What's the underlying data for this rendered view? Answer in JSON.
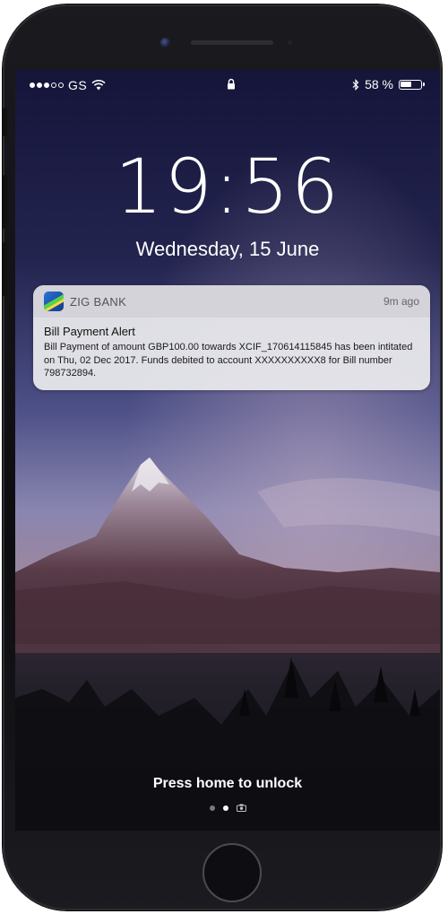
{
  "status_bar": {
    "carrier": "GS",
    "signal_strength": 3,
    "signal_max": 5,
    "battery_label": "58 %",
    "battery_level": 0.58,
    "icons": [
      "wifi-icon",
      "lock-icon",
      "bluetooth-icon",
      "battery-icon"
    ]
  },
  "lock_screen": {
    "time": "19:56",
    "date": "Wednesday, 15 June"
  },
  "notification": {
    "app_name": "ZIG BANK",
    "time_ago": "9m ago",
    "title": "Bill Payment Alert",
    "body": "Bill Payment of amount GBP100.00 towards XCIF_170614115845 has been intitated on Thu, 02 Dec 2017. Funds debited to account XXXXXXXXXX8 for Bill number 798732894."
  },
  "footer": {
    "unlock_hint": "Press home to unlock",
    "pages": 3,
    "active_page": 2
  },
  "colors": {
    "sky_top": "#1a1a3d",
    "sky_mid": "#5a5d95",
    "horizon": "#8d7a9a",
    "mountain": "#5a3e4c",
    "notification_bg": "#e8e8ec",
    "text_white": "#ffffff"
  }
}
